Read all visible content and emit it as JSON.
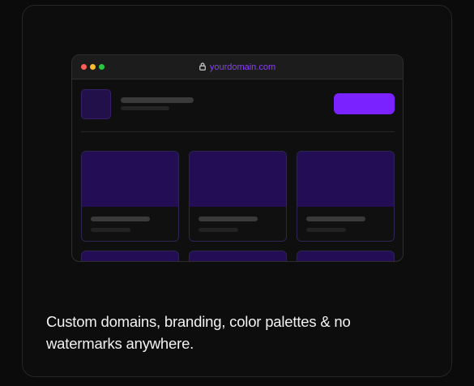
{
  "browser": {
    "url": "yourdomain.com",
    "accent_color": "#7a22ff",
    "icons": [
      "lock-icon"
    ]
  },
  "caption": "Custom domains, branding, color palettes & no watermarks anywhere."
}
